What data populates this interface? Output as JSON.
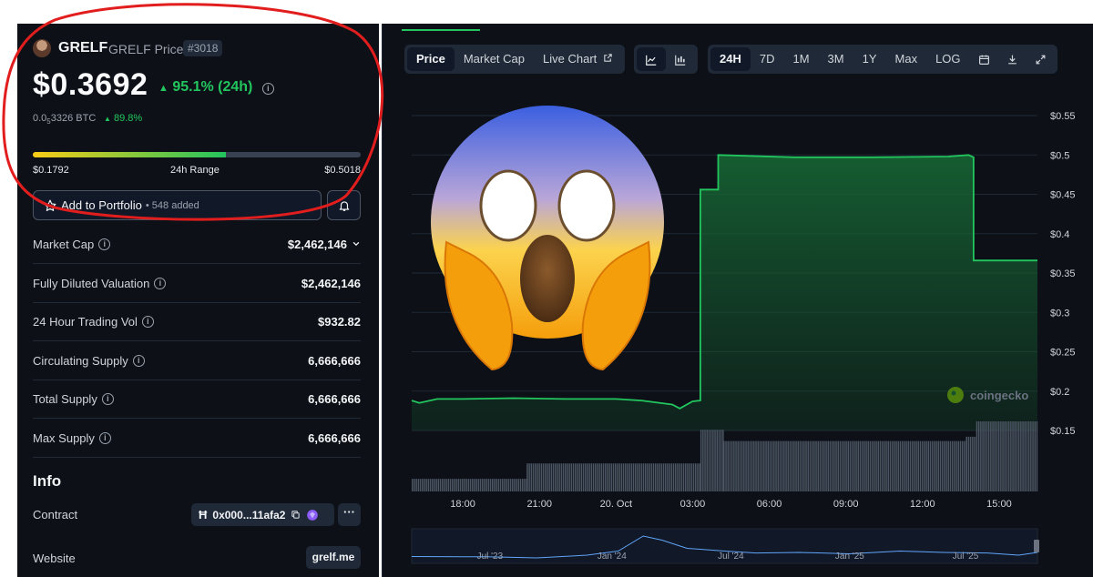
{
  "coin": {
    "symbol": "GRELF",
    "price_label": "GRELF Price",
    "rank": "#3018",
    "price": "$0.3692",
    "change_24h": "95.1% (24h)",
    "btc_price_prefix": "0.0",
    "btc_price_sub": "5",
    "btc_price_rest": "3326 BTC",
    "btc_change": "89.8%"
  },
  "range": {
    "low": "$0.1792",
    "label": "24h Range",
    "high": "$0.5018",
    "position": 0.59
  },
  "portfolio": {
    "button_label": "Add to Portfolio",
    "added_count": "• 548 added"
  },
  "stats": [
    {
      "label": "Market Cap",
      "value": "$2,462,146"
    },
    {
      "label": "Fully Diluted Valuation",
      "value": "$2,462,146"
    },
    {
      "label": "24 Hour Trading Vol",
      "value": "$932.82"
    },
    {
      "label": "Circulating Supply",
      "value": "6,666,666"
    },
    {
      "label": "Total Supply",
      "value": "6,666,666"
    },
    {
      "label": "Max Supply",
      "value": "6,666,666"
    }
  ],
  "info": {
    "title": "Info",
    "contract_label": "Contract",
    "contract_address": "0x000...11afa2",
    "website_label": "Website",
    "website": "grelf.me"
  },
  "chart_tabs": [
    "Price",
    "Market Cap",
    "Live Chart"
  ],
  "time_ranges": [
    "24H",
    "7D",
    "1M",
    "3M",
    "1Y",
    "Max",
    "LOG"
  ],
  "watermark": "coingecko",
  "colors": {
    "up": "#22c55e",
    "background": "#0d1117",
    "panel": "#1f2937"
  },
  "chart_data": {
    "type": "line",
    "y_ticks": [
      "$0.55",
      "$0.5",
      "$0.45",
      "$0.4",
      "$0.35",
      "$0.3",
      "$0.25",
      "$0.2",
      "$0.15"
    ],
    "x_ticks": [
      "18:00",
      "21:00",
      "20. Oct",
      "03:00",
      "06:00",
      "09:00",
      "12:00",
      "15:00"
    ],
    "ylim": [
      0.15,
      0.55
    ],
    "x_hours_range": [
      16.0,
      16.5
    ],
    "series": [
      {
        "x": [
          16.0,
          16.3,
          17.0,
          18.0,
          20.0,
          22.0,
          24.0,
          25.0,
          26.2,
          26.5,
          27.0,
          27.3,
          27.3,
          28.0,
          28.0,
          31.0,
          34.0,
          37.0,
          37.8,
          38.0,
          38.0,
          40.5
        ],
        "y": [
          0.188,
          0.185,
          0.19,
          0.19,
          0.191,
          0.19,
          0.19,
          0.188,
          0.183,
          0.178,
          0.187,
          0.188,
          0.456,
          0.456,
          0.5,
          0.497,
          0.497,
          0.498,
          0.5,
          0.497,
          0.366,
          0.366
        ]
      }
    ],
    "volume_levels": [
      {
        "from": 16.0,
        "to": 20.5,
        "level": 0.18
      },
      {
        "from": 20.5,
        "to": 27.3,
        "level": 0.4
      },
      {
        "from": 27.3,
        "to": 28.2,
        "level": 0.88
      },
      {
        "from": 28.2,
        "to": 37.7,
        "level": 0.72
      },
      {
        "from": 37.7,
        "to": 38.1,
        "level": 0.78
      },
      {
        "from": 38.1,
        "to": 40.5,
        "level": 1.0
      }
    ],
    "navigator_ticks": [
      "Jul '23",
      "Jan '24",
      "Jul '24",
      "Jan '25",
      "Jul '25"
    ]
  }
}
